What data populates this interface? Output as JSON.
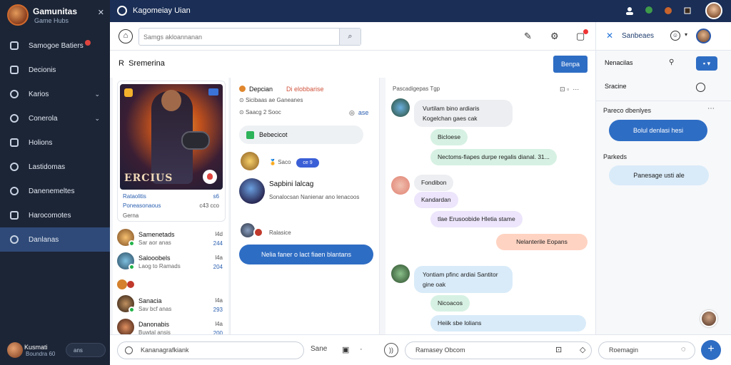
{
  "app": {
    "name": "Gamunitas",
    "subtitle": "Game Hubs",
    "close_icon": "close-icon"
  },
  "sidebar": {
    "items": [
      {
        "label": "Samogoe Batiers",
        "icon": "home-icon",
        "badge": true
      },
      {
        "label": "Decionis",
        "icon": "document-icon"
      },
      {
        "label": "Karios",
        "icon": "gamepad-icon",
        "chevron": true
      },
      {
        "label": "Conerola",
        "icon": "chat-icon",
        "chevron": true
      },
      {
        "label": "Holions",
        "icon": "folder-icon"
      },
      {
        "label": "Lastidomas",
        "icon": "controller-icon"
      },
      {
        "label": "Danenemeltes",
        "icon": "globe-icon"
      },
      {
        "label": "Harocomotes",
        "icon": "list-icon"
      },
      {
        "label": "Danlanas",
        "icon": "message-icon",
        "active": true
      }
    ],
    "user": {
      "name": "Kusmati",
      "status": "Boundra 60",
      "pill": "ans"
    }
  },
  "topbar": {
    "title": "Kagomeiay Uian"
  },
  "toolbar": {
    "search_placeholder": "Samgs akloannanan"
  },
  "right_header": {
    "label": "Sanbeaes"
  },
  "section": {
    "title": "Sremerina",
    "prefix": "R",
    "button": "Benpa"
  },
  "game_card": {
    "art_title": "ERCIUS",
    "meta1": "Rataolitis",
    "meta1_right": "s6",
    "meta2": "Poneasonaous",
    "meta2_right": "c43 cco",
    "meta3": "Gerna"
  },
  "friends": [
    {
      "name": "Samenetads",
      "status": "Sar aor anas",
      "time": "l4d",
      "count": "244"
    },
    {
      "name": "Salooobels",
      "status": "Laog to Ramads",
      "time": "l4a",
      "count": "204"
    },
    {
      "name": "Sanacia",
      "status": "Sav bcf anas",
      "time": "l4a",
      "count": "293"
    },
    {
      "name": "Danonabis",
      "status": "Buwtal ansis",
      "time": "l4a",
      "count": "200"
    }
  ],
  "feed": {
    "header": "Depcian",
    "header_tag": "Di elobbarise",
    "line1": "Sicibaas ae Ganeanes",
    "line2": "Saacg 2 Sooc",
    "line2_right": "ase",
    "pill": "Bebecicot",
    "like_label": "Saco",
    "like_tag": "ce 9",
    "post_name": "Sapbini lalcag",
    "post_body": "Sonalocsan Nanienar ano lenacoos",
    "comment_label": "Ralasice",
    "cta": "Nelia faner o lact fiaen blantans"
  },
  "chat": {
    "header": "Pascadigepas Tgp",
    "messages": [
      {
        "text": "Vurtilam bino ardiaris Kogelchan gaes cak",
        "style": "grey"
      },
      {
        "text": "Bicloese",
        "style": "green"
      },
      {
        "text": "Nectoms-fiapes durpe regalis dianal. 31...",
        "style": "green"
      },
      {
        "text": "Fondibon",
        "style": "grey"
      },
      {
        "text": "Kandardan",
        "style": "lav"
      },
      {
        "text": "tlae Erusoobide Hletia stame",
        "style": "lav"
      },
      {
        "text": "Nelanterile Eopans",
        "style": "peach"
      },
      {
        "text": "Yontiam pfinc ardiai Santitor gine oak",
        "style": "blue"
      },
      {
        "text": "Nicoacos",
        "style": "green"
      },
      {
        "text": "Heiik sbe lolians",
        "style": "blue"
      }
    ]
  },
  "right_panel": {
    "row1": "Nenacilas",
    "row2": "Sracine",
    "section1": "Pareco dbenlyes",
    "bubble1": "Bolul denlasi hesi",
    "section2": "Parkeds",
    "bubble2": "Panesage usti ale"
  },
  "bottom": {
    "input1": "Kananagrafkiank",
    "label": "Sane",
    "input2": "Ramasey Obcom",
    "input3": "Roemagin"
  },
  "colors": {
    "sidebar_bg": "#1c2536",
    "topbar_bg": "#1a2e56",
    "accent": "#2e6dc4"
  }
}
